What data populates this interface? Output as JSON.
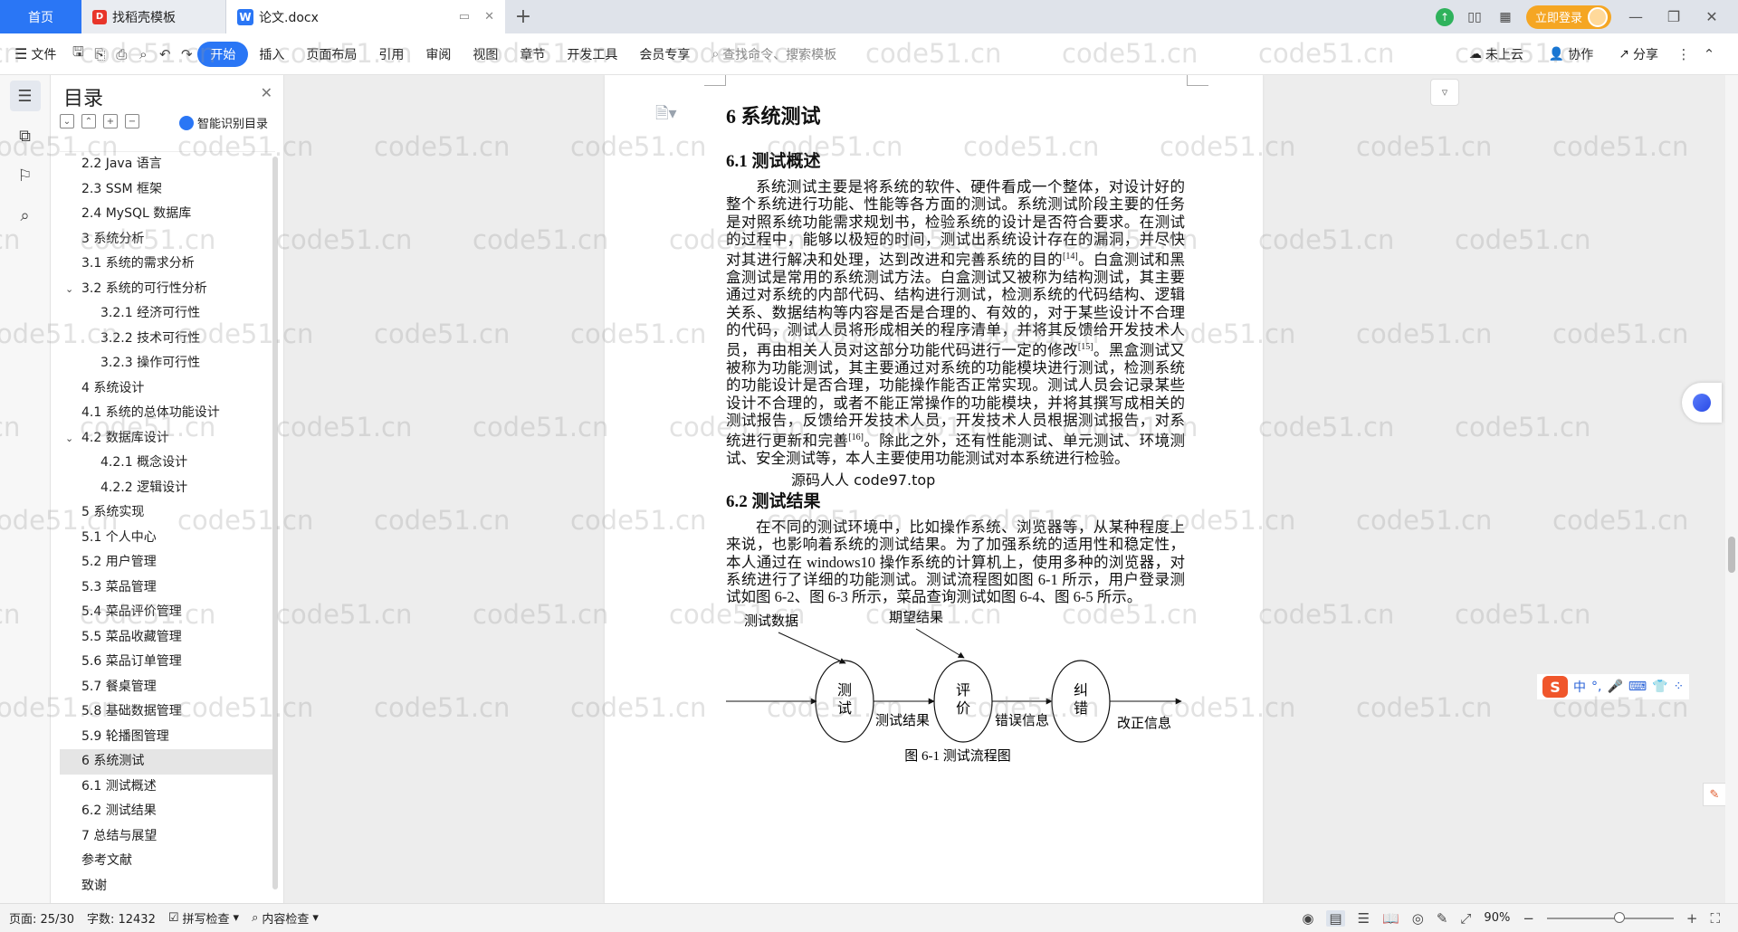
{
  "tabs": {
    "home": "首页",
    "template": "找稻壳模板",
    "doc": "论文.docx",
    "login": "立即登录"
  },
  "toolbar": {
    "file": "文件",
    "items": [
      "开始",
      "插入",
      "页面布局",
      "引用",
      "审阅",
      "视图",
      "章节",
      "开发工具",
      "会员专享"
    ],
    "search": "查找命令、搜索模板",
    "cloud": "未上云",
    "collab": "协作",
    "share": "分享"
  },
  "toc": {
    "title": "目录",
    "smart": "智能识别目录",
    "items": [
      "2.2 Java 语言",
      "2.3 SSM 框架",
      "2.4 MySQL 数据库",
      "3 系统分析",
      "3.1 系统的需求分析",
      "3.2 系统的可行性分析",
      "3.2.1 经济可行性",
      "3.2.2 技术可行性",
      "3.2.3 操作可行性",
      "4 系统设计",
      "4.1 系统的总体功能设计",
      "4.2 数据库设计",
      "4.2.1 概念设计",
      "4.2.2 逻辑设计",
      "5 系统实现",
      "5.1 个人中心",
      "5.2 用户管理",
      "5.3 菜品管理",
      "5.4 菜品评价管理",
      "5.5 菜品收藏管理",
      "5.6 菜品订单管理",
      "5.7 餐桌管理",
      "5.8 基础数据管理",
      "5.9 轮播图管理",
      "6 系统测试",
      "6.1 测试概述",
      "6.2 测试结果",
      "7 总结与展望",
      "参考文献",
      "致谢"
    ]
  },
  "doc": {
    "h1": "6 系统测试",
    "h2a": "6.1 测试概述",
    "p1_a": "系统测试主要是将系统的软件、硬件看成一个整体，对设计好的整个系统进行功能、性能等各方面的测试。系统测试阶段主要的任务是对照系统功能需求规划书，检验系统的设计是否符合要求。在测试的过程中，能够以极短的时间，测试出系统设计存在的漏洞，并尽快对其进行解决和处理，达到改进和完善系统的目的",
    "ref14": "[14]",
    "p1_b": "。白盒测试和黑盒测试是常用的系统测试方法。白盒测试又被称为结构测试，其主要通过对系统的内部代码、结构进行测试，检测系统的代码结构、逻辑关系、数据结构等内容是否是合理的、有效的，对于某些设计不合理的代码，测试人员将形成相关的程序清单，并将其反馈给开发技术人员，再由相关人员对这部分功能代码进行一定的修改",
    "ref15": "[15]",
    "p1_c": "。黑盒测试又被称为功能测试，其主要通过对系统的功能模块进行测试，检测系统的功能设计是否合理，功能操作能否正常实现。测试人员会记录某些设计不合理的，或者不能正常操作的功能模块，并将其撰写成相关的测试报告，反馈给开发技术人员，开发技术人员根据测试报告，对系统进行更新和完善",
    "ref16": "[16]",
    "p1_d": "。除此之外，还有性能测试、单元测试、环境测试、安全测试等，本人主要使用功能测试对本系统进行检验。",
    "overlay": "源码人人 code97.top",
    "h2b": "6.2 测试结果",
    "p2": "在不同的测试环境中，比如操作系统、浏览器等，从某种程度上来说，也影响着系统的测试结果。为了加强系统的适用性和稳定性，本人通过在 windows10 操作系统的计算机上，使用多种的浏览器，对系统进行了详细的功能测试。测试流程图如图 6-1 所示，用户登录测试如图 6-2、图 6-3 所示，菜品查询测试如图 6-4、图 6-5 所示。",
    "flow": {
      "input_label": "测试数据",
      "expected_label": "期望结果",
      "node1": [
        "测",
        "试"
      ],
      "node2": [
        "评",
        "价"
      ],
      "node3": [
        "纠",
        "错"
      ],
      "edge1": "测试结果",
      "edge2": "错误信息",
      "edge3": "改正信息",
      "caption": "图 6-1 测试流程图"
    }
  },
  "watermark": "code51.cn",
  "ime": {
    "lang": "中"
  },
  "status": {
    "page": "页面: 25/30",
    "words": "字数: 12432",
    "spell": "拼写检查",
    "content": "内容检查",
    "zoom": "90%"
  },
  "colors": {
    "accent": "#2a76f5",
    "login": "#f5a623"
  }
}
